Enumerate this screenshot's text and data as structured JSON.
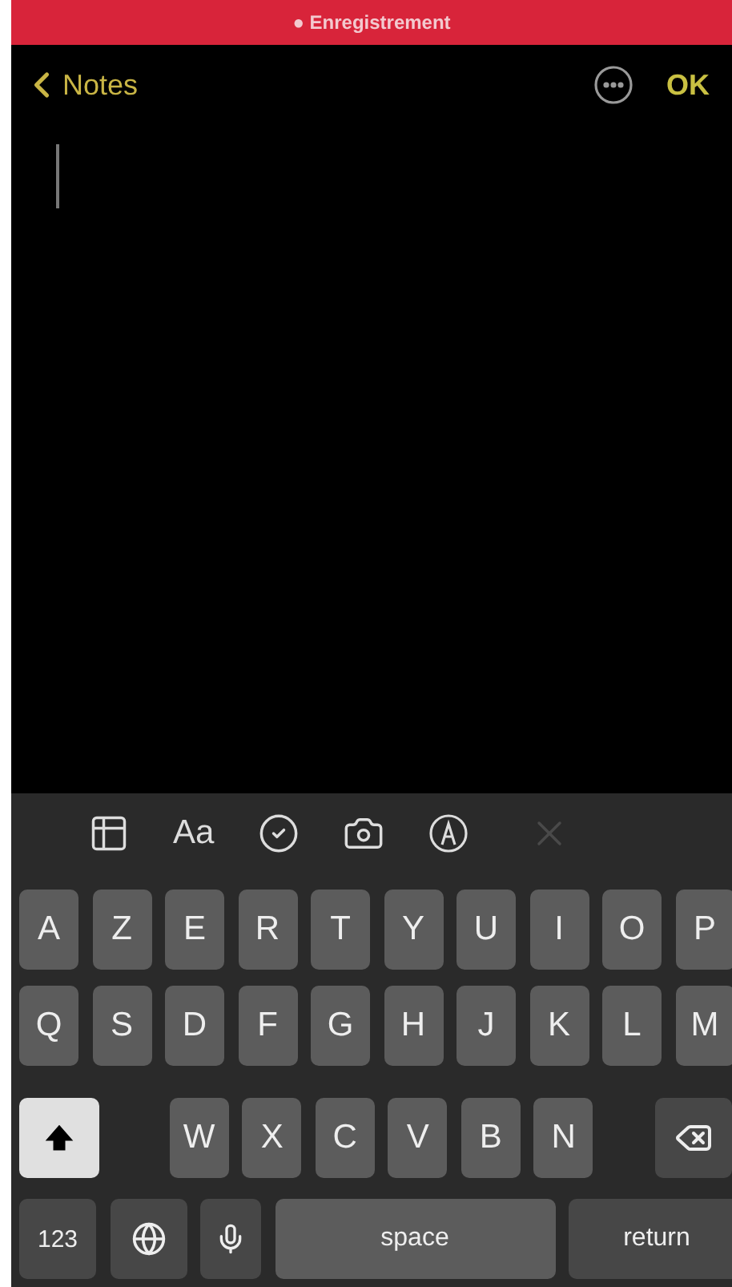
{
  "recording_bar": {
    "label": "● Enregistrement"
  },
  "nav": {
    "back": "Notes",
    "done": "OK"
  },
  "toolbar": [
    {
      "kind": "table"
    },
    {
      "kind": "text",
      "label": "Aa"
    },
    {
      "kind": "checklist"
    },
    {
      "kind": "camera"
    },
    {
      "kind": "markup"
    },
    {
      "kind": "close",
      "disabled": true
    }
  ],
  "keyboard": {
    "top_row": [
      "A",
      "Z",
      "E",
      "R",
      "T",
      "Y",
      "U",
      "I",
      "O",
      "P"
    ],
    "home_row": [
      "Q",
      "S",
      "D",
      "F",
      "G",
      "H",
      "J",
      "K",
      "L",
      "M"
    ],
    "bottom_row": [
      "W",
      "X",
      "C",
      "V",
      "B",
      "N"
    ],
    "shift": {
      "on": true
    },
    "numbers": "123",
    "space": "space",
    "return": "return"
  }
}
